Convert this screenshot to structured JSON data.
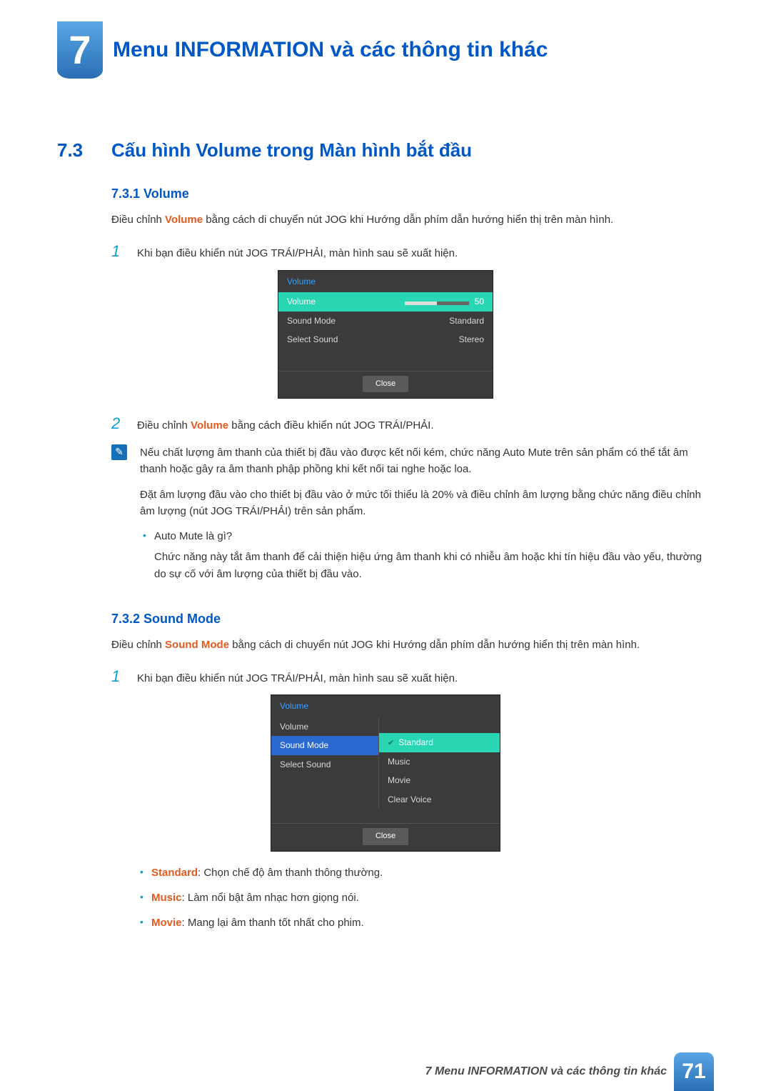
{
  "chapter": {
    "number": "7",
    "title": "Menu INFORMATION và các thông tin khác"
  },
  "section": {
    "number": "7.3",
    "title": "Cấu hình Volume trong Màn hình bắt đầu"
  },
  "sub1": {
    "number_title": "7.3.1  Volume",
    "intro_pre": "Điều chỉnh ",
    "intro_hl": "Volume",
    "intro_post": " bằng cách di chuyển nút JOG khi Hướng dẫn phím dẫn hướng hiển thị trên màn hình.",
    "step1_num": "1",
    "step1": "Khi bạn điều khiển nút JOG TRÁI/PHẢI, màn hình sau sẽ xuất hiện.",
    "step2_num": "2",
    "step2_pre": "Điều chỉnh ",
    "step2_hl": "Volume",
    "step2_post": " bằng cách điều khiển nút JOG TRÁI/PHẢI."
  },
  "osd1": {
    "title": "Volume",
    "row_volume": "Volume",
    "row_volume_val": "50",
    "row_soundmode": "Sound Mode",
    "row_soundmode_val": "Standard",
    "row_selectsound": "Select Sound",
    "row_selectsound_val": "Stereo",
    "close": "Close"
  },
  "note": {
    "p1": "Nếu chất lượng âm thanh của thiết bị đầu vào được kết nối kém, chức năng Auto Mute trên sản phẩm có thể tắt âm thanh hoặc gây ra âm thanh phập phồng khi kết nối tai nghe hoặc loa.",
    "p2": "Đặt âm lượng đầu vào cho thiết bị đầu vào ở mức tối thiểu là 20% và điều chỉnh âm lượng bằng chức năng điều chỉnh âm lượng (nút JOG TRÁI/PHẢI) trên sản phẩm.",
    "b1": "Auto Mute là gì?",
    "b1_desc": "Chức năng này tắt âm thanh để cải thiện hiệu ứng âm thanh khi có nhiễu âm hoặc khi tín hiệu đầu vào yếu, thường do sự cố với âm lượng của thiết bị đầu vào."
  },
  "sub2": {
    "number_title": "7.3.2  Sound Mode",
    "intro_pre": "Điều chỉnh ",
    "intro_hl": "Sound Mode",
    "intro_post": " bằng cách di chuyển nút JOG khi Hướng dẫn phím dẫn hướng hiển thị trên màn hình.",
    "step1_num": "1",
    "step1": "Khi bạn điều khiển nút JOG TRÁI/PHẢI, màn hình sau sẽ xuất hiện."
  },
  "osd2": {
    "title": "Volume",
    "left_volume": "Volume",
    "left_soundmode": "Sound Mode",
    "left_selectsound": "Select Sound",
    "opt_standard": "Standard",
    "opt_music": "Music",
    "opt_movie": "Movie",
    "opt_clearvoice": "Clear Voice",
    "close": "Close"
  },
  "modes": {
    "standard_label": "Standard",
    "standard_desc": ": Chọn chế độ âm thanh thông thường.",
    "music_label": "Music",
    "music_desc": ": Làm nổi bật âm nhạc hơn giọng nói.",
    "movie_label": "Movie",
    "movie_desc": ": Mang lại âm thanh tốt nhất cho phim."
  },
  "footer": {
    "text": "7 Menu INFORMATION và các thông tin khác",
    "page": "71"
  }
}
